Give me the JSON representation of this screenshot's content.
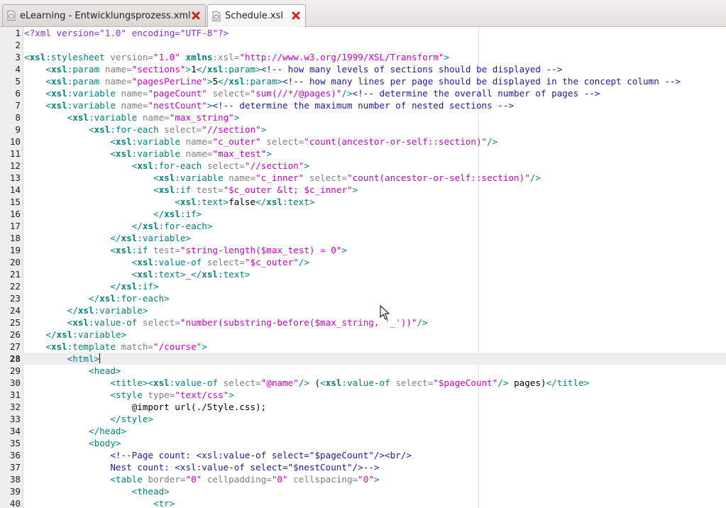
{
  "tabs": [
    {
      "label": "eLearning - Entwicklungsprozess.xml",
      "active": false,
      "icon": "xml-file-icon"
    },
    {
      "label": "Schedule.xsl",
      "active": true,
      "icon": "xsl-file-icon"
    }
  ],
  "editor": {
    "current_line": 28,
    "lines": [
      {
        "n": "1",
        "tokens": [
          [
            "pi",
            "<?xml version=\"1.0\" encoding=\"UTF-8\"?>"
          ]
        ]
      },
      {
        "n": "2",
        "tokens": []
      },
      {
        "n": "3",
        "tokens": [
          [
            "b",
            "<"
          ],
          [
            "pf",
            "xsl"
          ],
          [
            "b",
            ":stylesheet "
          ],
          [
            "an",
            "version="
          ],
          [
            "av",
            "\"1.0\" "
          ],
          [
            "pf",
            "xmlns"
          ],
          [
            "an",
            ":xsl="
          ],
          [
            "av",
            "\"http://www.w3.org/1999/XSL/Transform\""
          ],
          [
            "b",
            ">"
          ]
        ]
      },
      {
        "n": "4",
        "tokens": [
          [
            "tx",
            "    "
          ],
          [
            "b",
            "<"
          ],
          [
            "pf",
            "xsl"
          ],
          [
            "b",
            ":param "
          ],
          [
            "an",
            "name="
          ],
          [
            "av",
            "\"sections\""
          ],
          [
            "b",
            ">"
          ],
          [
            "tx",
            "1"
          ],
          [
            "b",
            "</"
          ],
          [
            "pf",
            "xsl"
          ],
          [
            "b",
            ":param>"
          ],
          [
            "cm",
            "<!-- how many levels of sections should be displayed -->"
          ]
        ]
      },
      {
        "n": "5",
        "tokens": [
          [
            "tx",
            "    "
          ],
          [
            "b",
            "<"
          ],
          [
            "pf",
            "xsl"
          ],
          [
            "b",
            ":param "
          ],
          [
            "an",
            "name="
          ],
          [
            "av",
            "\"pagesPerLine\""
          ],
          [
            "b",
            ">"
          ],
          [
            "tx",
            "5"
          ],
          [
            "b",
            "</"
          ],
          [
            "pf",
            "xsl"
          ],
          [
            "b",
            ":param>"
          ],
          [
            "cm",
            "<!-- how many lines per page should be displayed in the concept column -->"
          ]
        ]
      },
      {
        "n": "6",
        "tokens": [
          [
            "tx",
            "    "
          ],
          [
            "b",
            "<"
          ],
          [
            "pf",
            "xsl"
          ],
          [
            "b",
            ":variable "
          ],
          [
            "an",
            "name="
          ],
          [
            "av",
            "\"pageCount\" "
          ],
          [
            "an",
            "select="
          ],
          [
            "av",
            "\"sum(//*/@pages)\""
          ],
          [
            "b",
            "/>"
          ],
          [
            "cm",
            "<!-- determine the overall number of pages -->"
          ]
        ]
      },
      {
        "n": "7",
        "tokens": [
          [
            "tx",
            "    "
          ],
          [
            "b",
            "<"
          ],
          [
            "pf",
            "xsl"
          ],
          [
            "b",
            ":variable "
          ],
          [
            "an",
            "name="
          ],
          [
            "av",
            "\"nestCount\""
          ],
          [
            "b",
            ">"
          ],
          [
            "cm",
            "<!-- determine the maximum number of nested sections -->"
          ]
        ]
      },
      {
        "n": "8",
        "tokens": [
          [
            "tx",
            "        "
          ],
          [
            "b",
            "<"
          ],
          [
            "pf",
            "xsl"
          ],
          [
            "b",
            ":variable "
          ],
          [
            "an",
            "name="
          ],
          [
            "av",
            "\"max_string\""
          ],
          [
            "b",
            ">"
          ]
        ]
      },
      {
        "n": "9",
        "tokens": [
          [
            "tx",
            "            "
          ],
          [
            "b",
            "<"
          ],
          [
            "pf",
            "xsl"
          ],
          [
            "b",
            ":for-each "
          ],
          [
            "an",
            "select="
          ],
          [
            "av",
            "\"//section\""
          ],
          [
            "b",
            ">"
          ]
        ]
      },
      {
        "n": "10",
        "tokens": [
          [
            "tx",
            "                "
          ],
          [
            "b",
            "<"
          ],
          [
            "pf",
            "xsl"
          ],
          [
            "b",
            ":variable "
          ],
          [
            "an",
            "name="
          ],
          [
            "av",
            "\"c_outer\" "
          ],
          [
            "an",
            "select="
          ],
          [
            "av",
            "\"count(ancestor-or-self::section)\""
          ],
          [
            "b",
            "/>"
          ]
        ]
      },
      {
        "n": "11",
        "tokens": [
          [
            "tx",
            "                "
          ],
          [
            "b",
            "<"
          ],
          [
            "pf",
            "xsl"
          ],
          [
            "b",
            ":variable "
          ],
          [
            "an",
            "name="
          ],
          [
            "av",
            "\"max_test\""
          ],
          [
            "b",
            ">"
          ]
        ]
      },
      {
        "n": "12",
        "tokens": [
          [
            "tx",
            "                    "
          ],
          [
            "b",
            "<"
          ],
          [
            "pf",
            "xsl"
          ],
          [
            "b",
            ":for-each "
          ],
          [
            "an",
            "select="
          ],
          [
            "av",
            "\"//section\""
          ],
          [
            "b",
            ">"
          ]
        ]
      },
      {
        "n": "13",
        "tokens": [
          [
            "tx",
            "                        "
          ],
          [
            "b",
            "<"
          ],
          [
            "pf",
            "xsl"
          ],
          [
            "b",
            ":variable "
          ],
          [
            "an",
            "name="
          ],
          [
            "av",
            "\"c_inner\" "
          ],
          [
            "an",
            "select="
          ],
          [
            "av",
            "\"count(ancestor-or-self::section)\""
          ],
          [
            "b",
            "/>"
          ]
        ]
      },
      {
        "n": "14",
        "tokens": [
          [
            "tx",
            "                        "
          ],
          [
            "b",
            "<"
          ],
          [
            "pf",
            "xsl"
          ],
          [
            "b",
            ":if "
          ],
          [
            "an",
            "test="
          ],
          [
            "av",
            "\"$c_outer &lt; $c_inner\""
          ],
          [
            "b",
            ">"
          ]
        ]
      },
      {
        "n": "15",
        "tokens": [
          [
            "tx",
            "                            "
          ],
          [
            "b",
            "<"
          ],
          [
            "pf",
            "xsl"
          ],
          [
            "b",
            ":text>"
          ],
          [
            "tx",
            "false"
          ],
          [
            "b",
            "</"
          ],
          [
            "pf",
            "xsl"
          ],
          [
            "b",
            ":text>"
          ]
        ]
      },
      {
        "n": "16",
        "tokens": [
          [
            "tx",
            "                        "
          ],
          [
            "b",
            "</"
          ],
          [
            "pf",
            "xsl"
          ],
          [
            "b",
            ":if>"
          ]
        ]
      },
      {
        "n": "17",
        "tokens": [
          [
            "tx",
            "                    "
          ],
          [
            "b",
            "</"
          ],
          [
            "pf",
            "xsl"
          ],
          [
            "b",
            ":for-each>"
          ]
        ]
      },
      {
        "n": "18",
        "tokens": [
          [
            "tx",
            "                "
          ],
          [
            "b",
            "</"
          ],
          [
            "pf",
            "xsl"
          ],
          [
            "b",
            ":variable>"
          ]
        ]
      },
      {
        "n": "19",
        "tokens": [
          [
            "tx",
            "                "
          ],
          [
            "b",
            "<"
          ],
          [
            "pf",
            "xsl"
          ],
          [
            "b",
            ":if "
          ],
          [
            "an",
            "test="
          ],
          [
            "av",
            "\"string-length($max_test) = 0\""
          ],
          [
            "b",
            ">"
          ]
        ]
      },
      {
        "n": "20",
        "tokens": [
          [
            "tx",
            "                    "
          ],
          [
            "b",
            "<"
          ],
          [
            "pf",
            "xsl"
          ],
          [
            "b",
            ":value-of "
          ],
          [
            "an",
            "select="
          ],
          [
            "av",
            "\"$c_outer\""
          ],
          [
            "b",
            "/>"
          ]
        ]
      },
      {
        "n": "21",
        "tokens": [
          [
            "tx",
            "                    "
          ],
          [
            "b",
            "<"
          ],
          [
            "pf",
            "xsl"
          ],
          [
            "b",
            ":text>"
          ],
          [
            "tx",
            "_"
          ],
          [
            "b",
            "</"
          ],
          [
            "pf",
            "xsl"
          ],
          [
            "b",
            ":text>"
          ]
        ]
      },
      {
        "n": "22",
        "tokens": [
          [
            "tx",
            "                "
          ],
          [
            "b",
            "</"
          ],
          [
            "pf",
            "xsl"
          ],
          [
            "b",
            ":if>"
          ]
        ]
      },
      {
        "n": "23",
        "tokens": [
          [
            "tx",
            "            "
          ],
          [
            "b",
            "</"
          ],
          [
            "pf",
            "xsl"
          ],
          [
            "b",
            ":for-each>"
          ]
        ]
      },
      {
        "n": "24",
        "tokens": [
          [
            "tx",
            "        "
          ],
          [
            "b",
            "</"
          ],
          [
            "pf",
            "xsl"
          ],
          [
            "b",
            ":variable>"
          ]
        ]
      },
      {
        "n": "25",
        "tokens": [
          [
            "tx",
            "        "
          ],
          [
            "b",
            "<"
          ],
          [
            "pf",
            "xsl"
          ],
          [
            "b",
            ":value-of "
          ],
          [
            "an",
            "select="
          ],
          [
            "av",
            "\"number(substring-before($max_string, '_'))\""
          ],
          [
            "b",
            "/>"
          ]
        ]
      },
      {
        "n": "26",
        "tokens": [
          [
            "tx",
            "    "
          ],
          [
            "b",
            "</"
          ],
          [
            "pf",
            "xsl"
          ],
          [
            "b",
            ":variable>"
          ]
        ]
      },
      {
        "n": "27",
        "tokens": [
          [
            "tx",
            "    "
          ],
          [
            "b",
            "<"
          ],
          [
            "pf",
            "xsl"
          ],
          [
            "b",
            ":template "
          ],
          [
            "an",
            "match="
          ],
          [
            "av",
            "\"/course\""
          ],
          [
            "b",
            ">"
          ]
        ]
      },
      {
        "n": "28",
        "tokens": [
          [
            "tx",
            "        "
          ],
          [
            "b",
            "<html>"
          ]
        ]
      },
      {
        "n": "29",
        "tokens": [
          [
            "tx",
            "            "
          ],
          [
            "b",
            "<head>"
          ]
        ]
      },
      {
        "n": "30",
        "tokens": [
          [
            "tx",
            "                "
          ],
          [
            "b",
            "<title><"
          ],
          [
            "pf",
            "xsl"
          ],
          [
            "b",
            ":value-of "
          ],
          [
            "an",
            "select="
          ],
          [
            "av",
            "\"@name\""
          ],
          [
            "b",
            "/>"
          ],
          [
            "tx",
            " ("
          ],
          [
            "b",
            "<"
          ],
          [
            "pf",
            "xsl"
          ],
          [
            "b",
            ":value-of "
          ],
          [
            "an",
            "select="
          ],
          [
            "av",
            "\"$pageCount\""
          ],
          [
            "b",
            "/>"
          ],
          [
            "tx",
            " pages)"
          ],
          [
            "b",
            "</title>"
          ]
        ]
      },
      {
        "n": "31",
        "tokens": [
          [
            "tx",
            "                "
          ],
          [
            "b",
            "<style "
          ],
          [
            "an",
            "type="
          ],
          [
            "av",
            "\"text/css\""
          ],
          [
            "b",
            ">"
          ]
        ]
      },
      {
        "n": "32",
        "tokens": [
          [
            "tx",
            "                    @import url(./Style.css);"
          ]
        ]
      },
      {
        "n": "33",
        "tokens": [
          [
            "tx",
            "                "
          ],
          [
            "b",
            "</style>"
          ]
        ]
      },
      {
        "n": "34",
        "tokens": [
          [
            "tx",
            "            "
          ],
          [
            "b",
            "</head>"
          ]
        ]
      },
      {
        "n": "35",
        "tokens": [
          [
            "tx",
            "            "
          ],
          [
            "b",
            "<body>"
          ]
        ]
      },
      {
        "n": "36",
        "tokens": [
          [
            "tx",
            "                "
          ],
          [
            "cm",
            "<!--Page count: <xsl:value-of select=\"$pageCount\"/><br/>"
          ]
        ]
      },
      {
        "n": "37",
        "tokens": [
          [
            "tx",
            "                "
          ],
          [
            "cm",
            "Nest count: <xsl:value-of select=\"$nestCount\"/>-->"
          ]
        ]
      },
      {
        "n": "38",
        "tokens": [
          [
            "tx",
            "                "
          ],
          [
            "b",
            "<table "
          ],
          [
            "an",
            "border="
          ],
          [
            "av",
            "\"0\" "
          ],
          [
            "an",
            "cellpadding="
          ],
          [
            "av",
            "\"0\" "
          ],
          [
            "an",
            "cellspacing="
          ],
          [
            "av",
            "\"0\""
          ],
          [
            "b",
            ">"
          ]
        ]
      },
      {
        "n": "39",
        "tokens": [
          [
            "tx",
            "                    "
          ],
          [
            "b",
            "<thead>"
          ]
        ]
      },
      {
        "n": "40",
        "tokens": [
          [
            "tx",
            "                        "
          ],
          [
            "b",
            "<tr>"
          ]
        ]
      }
    ]
  }
}
